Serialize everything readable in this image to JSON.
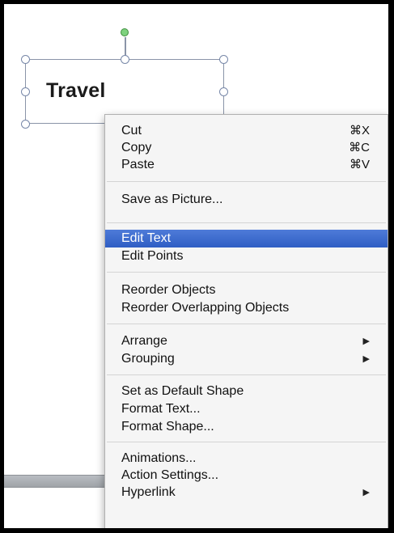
{
  "shape": {
    "text": "Travel"
  },
  "menu": {
    "items": [
      {
        "label": "Cut",
        "shortcut": "⌘X"
      },
      {
        "label": "Copy",
        "shortcut": "⌘C"
      },
      {
        "label": "Paste",
        "shortcut": "⌘V"
      },
      {
        "label": "Save as Picture..."
      },
      {
        "label": "Edit Text",
        "highlighted": true
      },
      {
        "label": "Edit Points"
      },
      {
        "label": "Reorder Objects"
      },
      {
        "label": "Reorder Overlapping Objects"
      },
      {
        "label": "Arrange",
        "submenu": true
      },
      {
        "label": "Grouping",
        "submenu": true
      },
      {
        "label": "Set as Default Shape"
      },
      {
        "label": "Format Text..."
      },
      {
        "label": "Format Shape..."
      },
      {
        "label": "Animations..."
      },
      {
        "label": "Action Settings..."
      },
      {
        "label": "Hyperlink",
        "submenu": true
      }
    ],
    "submenu_arrow": "▶",
    "highlight_color": "#3a67cc"
  },
  "icons": {
    "rotate": "rotate-handle-icon",
    "resize": "resize-handle-icon",
    "submenu": "triangle-right-icon"
  }
}
